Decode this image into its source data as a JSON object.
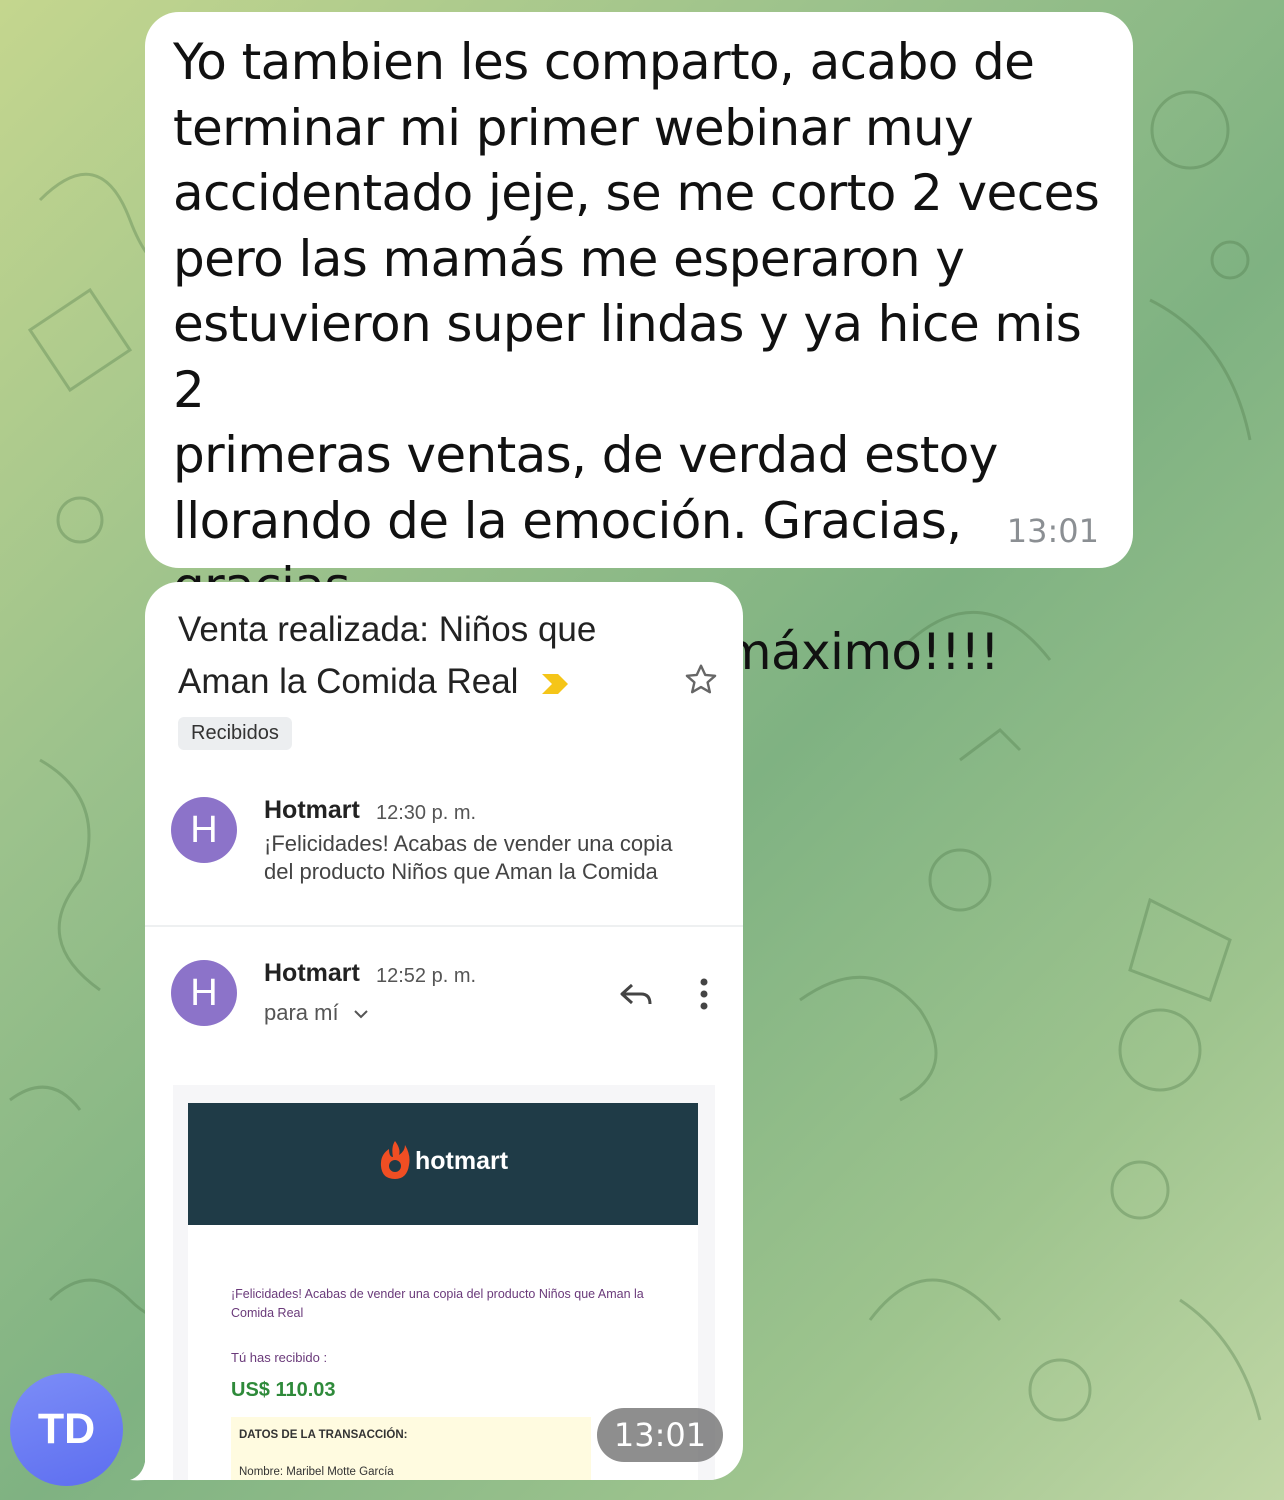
{
  "message1": {
    "text": "Yo tambien les comparto, acabo de\nterminar mi primer webinar muy\naccidentado jeje, se me corto 2 veces\npero las mamás me esperaron y\nestuvieron super lindas y ya hice mis 2\nprimeras ventas, de verdad estoy\nllorando de la emoción. Gracias, gracias,\ngracias equipo, son lo máximo!!!!",
    "time": "13:01"
  },
  "message2": {
    "time": "13:01",
    "email": {
      "subject": "Venta realizada: Niños que Aman la Comida Real",
      "label": "Recibidos",
      "thread": [
        {
          "avatar": "H",
          "sender": "Hotmart",
          "time": "12:30 p. m.",
          "snippet": "¡Felicidades! Acabas de vender una copia del producto Niños que Aman la Comida"
        },
        {
          "avatar": "H",
          "sender": "Hotmart",
          "time": "12:52 p. m.",
          "to": "para mí"
        }
      ],
      "body": {
        "brand": "hotmart",
        "congrats": "¡Felicidades! Acabas de vender una copia del producto Niños que Aman la Comida Real",
        "received_label": "Tú has recibido :",
        "amount": "US$ 110.03",
        "transaction_title": "DATOS DE LA TRANSACCIÓN:",
        "buyer_name": "Nombre: Maribel Motte García"
      }
    }
  },
  "user": {
    "initials": "TD",
    "avatar_color": "#6a7cf3"
  },
  "colors": {
    "hotmart_header": "#1f3b47",
    "hotmart_flame": "#f04e23",
    "avatar_h": "#8c73c9",
    "amount": "#2e8a3a"
  }
}
